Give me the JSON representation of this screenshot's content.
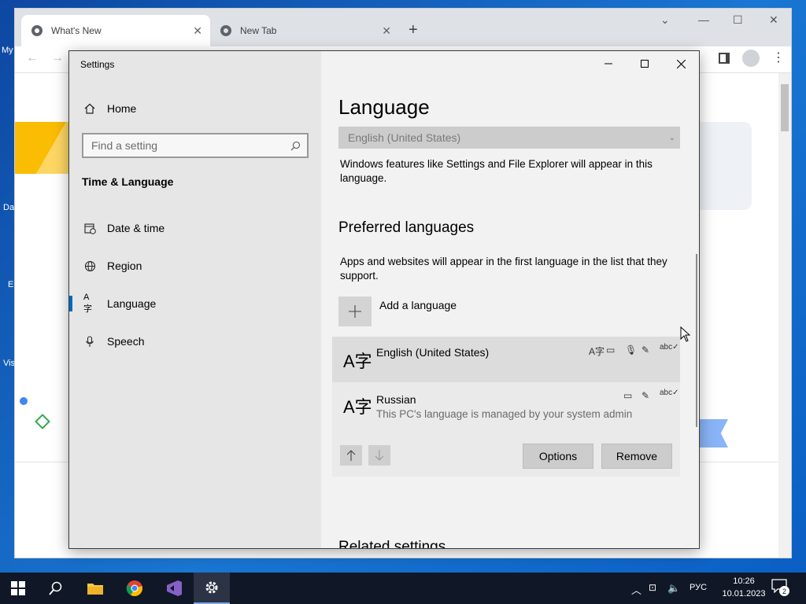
{
  "browser": {
    "tabs": [
      {
        "label": "What's New"
      },
      {
        "label": "New Tab"
      }
    ],
    "new_tab_symbol": "+"
  },
  "desktop": {
    "labels": [
      "My",
      "Da",
      "E",
      "Vis"
    ]
  },
  "settings": {
    "window_title": "Settings",
    "sidebar": {
      "home_label": "Home",
      "search_placeholder": "Find a setting",
      "section_title": "Time & Language",
      "items": [
        {
          "label": "Date & time",
          "icon": "calendar-clock-icon"
        },
        {
          "label": "Region",
          "icon": "globe-icon"
        },
        {
          "label": "Language",
          "icon": "language-icon",
          "selected": true
        },
        {
          "label": "Speech",
          "icon": "microphone-icon"
        }
      ]
    },
    "content": {
      "page_title": "Language",
      "display_language_value": "English (United States)",
      "display_language_desc": "Windows features like Settings and File Explorer will appear in this language.",
      "preferred_title": "Preferred languages",
      "preferred_desc": "Apps and websites will appear in the first language in the list that they support.",
      "add_language_label": "Add a language",
      "languages": [
        {
          "name": "English (United States)",
          "subtitle": "",
          "glyph": "A字",
          "features": [
            "display-language-icon",
            "text-to-speech-icon",
            "speech-recognition-icon",
            "handwriting-icon",
            "spellcheck-icon"
          ]
        },
        {
          "name": "Russian",
          "subtitle": "This PC's language is managed by your system admin",
          "glyph": "A字",
          "features": [
            "text-to-speech-icon",
            "handwriting-icon",
            "spellcheck-icon"
          ]
        }
      ],
      "options_label": "Options",
      "remove_label": "Remove",
      "related_title": "Related settings"
    }
  },
  "taskbar": {
    "input_language": "РУС",
    "time": "10:26",
    "date": "10.01.2023",
    "notification_count": "2"
  }
}
